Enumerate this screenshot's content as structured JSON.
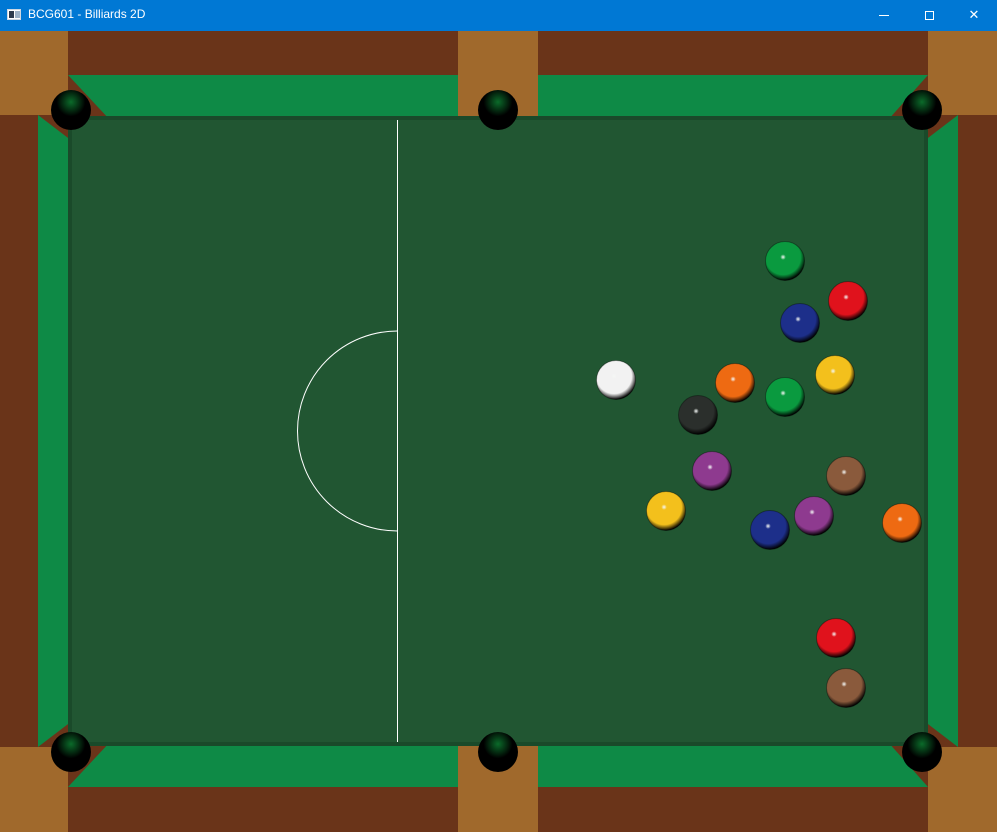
{
  "window": {
    "title": "BCG601 - Billiards 2D",
    "controls": {
      "minimize": "minimize",
      "maximize": "maximize",
      "close": "✕"
    }
  },
  "game": {
    "colors": {
      "wood": "#6a3419",
      "corner_wood": "#a0692c",
      "cushion": "#0e8a46",
      "cushion_shadow": "#09572c",
      "felt": "#215632",
      "line": "#ffffff",
      "pocket": "#000000"
    },
    "balls": [
      {
        "id": "cue",
        "color": "#f2f2f2"
      },
      {
        "id": "green-1",
        "color": "#0a9a3f"
      },
      {
        "id": "red-1",
        "color": "#e0121c"
      },
      {
        "id": "blue-1",
        "color": "#1d2f8a"
      },
      {
        "id": "orange-1",
        "color": "#ee6a12"
      },
      {
        "id": "yellow-1",
        "color": "#f3c01c"
      },
      {
        "id": "green-2",
        "color": "#0a9a3f"
      },
      {
        "id": "black",
        "color": "#2b2f2c"
      },
      {
        "id": "purple-1",
        "color": "#8e3a8f"
      },
      {
        "id": "brown-1",
        "color": "#8a5a3c"
      },
      {
        "id": "yellow-2",
        "color": "#f3c01c"
      },
      {
        "id": "purple-2",
        "color": "#8e3a8f"
      },
      {
        "id": "blue-2",
        "color": "#1d2f8a"
      },
      {
        "id": "orange-2",
        "color": "#ee6a12"
      },
      {
        "id": "red-2",
        "color": "#e0121c"
      },
      {
        "id": "brown-2",
        "color": "#8a5a3c"
      }
    ]
  }
}
